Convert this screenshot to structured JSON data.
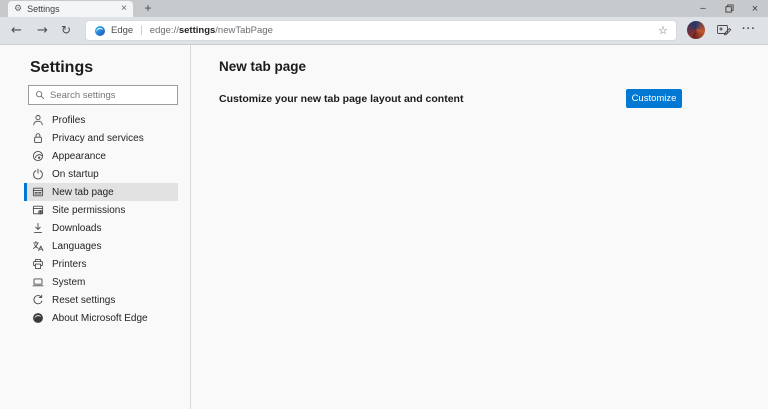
{
  "window": {
    "tab": {
      "favicon_glyph": "⚙",
      "title": "Settings",
      "close_glyph": "×"
    },
    "new_tab_glyph": "+",
    "controls": {
      "minimize_glyph": "–",
      "close_glyph": "×"
    }
  },
  "toolbar": {
    "back_glyph": "←",
    "forward_glyph": "→",
    "refresh_glyph": "↻",
    "address": {
      "site_label": "Edge",
      "separator": "|",
      "url_scheme": "edge://",
      "url_host": "settings",
      "url_path": "/newTabPage",
      "star_glyph": "☆"
    },
    "more_glyph": "···"
  },
  "sidebar": {
    "title": "Settings",
    "search_placeholder": "Search settings",
    "items": [
      {
        "label": "Profiles",
        "icon": "person",
        "selected": false
      },
      {
        "label": "Privacy and services",
        "icon": "lock",
        "selected": false
      },
      {
        "label": "Appearance",
        "icon": "appearance",
        "selected": false
      },
      {
        "label": "On startup",
        "icon": "power",
        "selected": false
      },
      {
        "label": "New tab page",
        "icon": "newtab",
        "selected": true
      },
      {
        "label": "Site permissions",
        "icon": "permissions",
        "selected": false
      },
      {
        "label": "Downloads",
        "icon": "download",
        "selected": false
      },
      {
        "label": "Languages",
        "icon": "languages",
        "selected": false
      },
      {
        "label": "Printers",
        "icon": "printer",
        "selected": false
      },
      {
        "label": "System",
        "icon": "system",
        "selected": false
      },
      {
        "label": "Reset settings",
        "icon": "reset",
        "selected": false
      },
      {
        "label": "About Microsoft Edge",
        "icon": "edge",
        "selected": false
      }
    ]
  },
  "main": {
    "title": "New tab page",
    "setting_label": "Customize your new tab page layout and content",
    "button_label": "Customize"
  },
  "colors": {
    "accent": "#0078d4",
    "selected_bg": "#e2e2e2",
    "titlebar_bg": "#c7cacd",
    "toolbar_bg": "#dee1e5"
  }
}
